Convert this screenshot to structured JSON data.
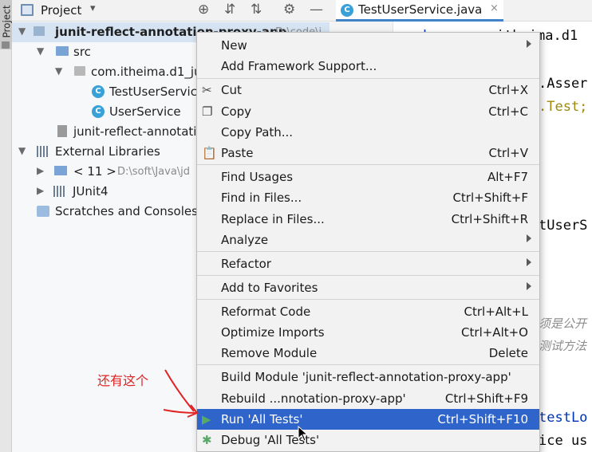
{
  "side_tab": {
    "label": "Project"
  },
  "project_panel": {
    "title": "Project",
    "dropdown_icon": "chevron-down-icon",
    "header_icons": [
      "target-icon",
      "expand-all-icon",
      "collapse-all-icon",
      "gear-icon",
      "minimize-icon"
    ]
  },
  "tree": {
    "root": {
      "name": "junit-reflect-annotation-proxy-app",
      "path": "D:\\code\\j"
    },
    "src": "src",
    "package": "com.itheima.d1_ju",
    "class1": "TestUserServic",
    "class2": "UserService",
    "iml_file": "junit-reflect-annotati",
    "external_libraries": "External Libraries",
    "jdk": {
      "name": "< 11 >",
      "path": "D:\\soft\\Java\\jd"
    },
    "junit": "JUnit4",
    "scratches": "Scratches and Consoles"
  },
  "editor": {
    "tab_label": "TestUserService.java",
    "tab_close": "×",
    "code": {
      "line1_kw": "package",
      "line1_rest": " com.itheima.d1",
      "line2": ".Asser",
      "line3": ".Test;",
      "line4": "tUserS",
      "line5": "须是公开",
      "line6": "测试方法",
      "line7": "testLo",
      "line8": "ice us"
    }
  },
  "context_menu": {
    "items": [
      {
        "label": "New",
        "shortcut": "",
        "submenu": true
      },
      {
        "label": "Add Framework Support...",
        "shortcut": "",
        "submenu": false
      },
      {
        "label": "Cut",
        "shortcut": "Ctrl+X",
        "icon": "scissors-icon"
      },
      {
        "label": "Copy",
        "shortcut": "Ctrl+C",
        "icon": "copy-icon"
      },
      {
        "label": "Copy Path...",
        "shortcut": ""
      },
      {
        "label": "Paste",
        "shortcut": "Ctrl+V",
        "icon": "clipboard-icon"
      },
      {
        "label": "Find Usages",
        "shortcut": "Alt+F7"
      },
      {
        "label": "Find in Files...",
        "shortcut": "Ctrl+Shift+F"
      },
      {
        "label": "Replace in Files...",
        "shortcut": "Ctrl+Shift+R"
      },
      {
        "label": "Analyze",
        "shortcut": "",
        "submenu": true
      },
      {
        "label": "Refactor",
        "shortcut": "",
        "submenu": true
      },
      {
        "label": "Add to Favorites",
        "shortcut": "",
        "submenu": true
      },
      {
        "label": "Reformat Code",
        "shortcut": "Ctrl+Alt+L"
      },
      {
        "label": "Optimize Imports",
        "shortcut": "Ctrl+Alt+O"
      },
      {
        "label": "Remove Module",
        "shortcut": "Delete"
      },
      {
        "label": "Build Module 'junit-reflect-annotation-proxy-app'",
        "shortcut": ""
      },
      {
        "label": "Rebuild ...nnotation-proxy-app'",
        "shortcut": "Ctrl+Shift+F9"
      },
      {
        "label": "Run 'All Tests'",
        "shortcut": "Ctrl+Shift+F10",
        "icon": "run-icon",
        "highlighted": true
      },
      {
        "label": "Debug 'All Tests'",
        "shortcut": "",
        "icon": "debug-icon"
      }
    ]
  },
  "annotation": {
    "text": "还有这个",
    "color": "#e02424"
  },
  "colors": {
    "selection": "#2f65ca",
    "menu_bg": "#f2f2f2",
    "keyword": "#0033b3",
    "annotation_code": "#9e880d"
  }
}
